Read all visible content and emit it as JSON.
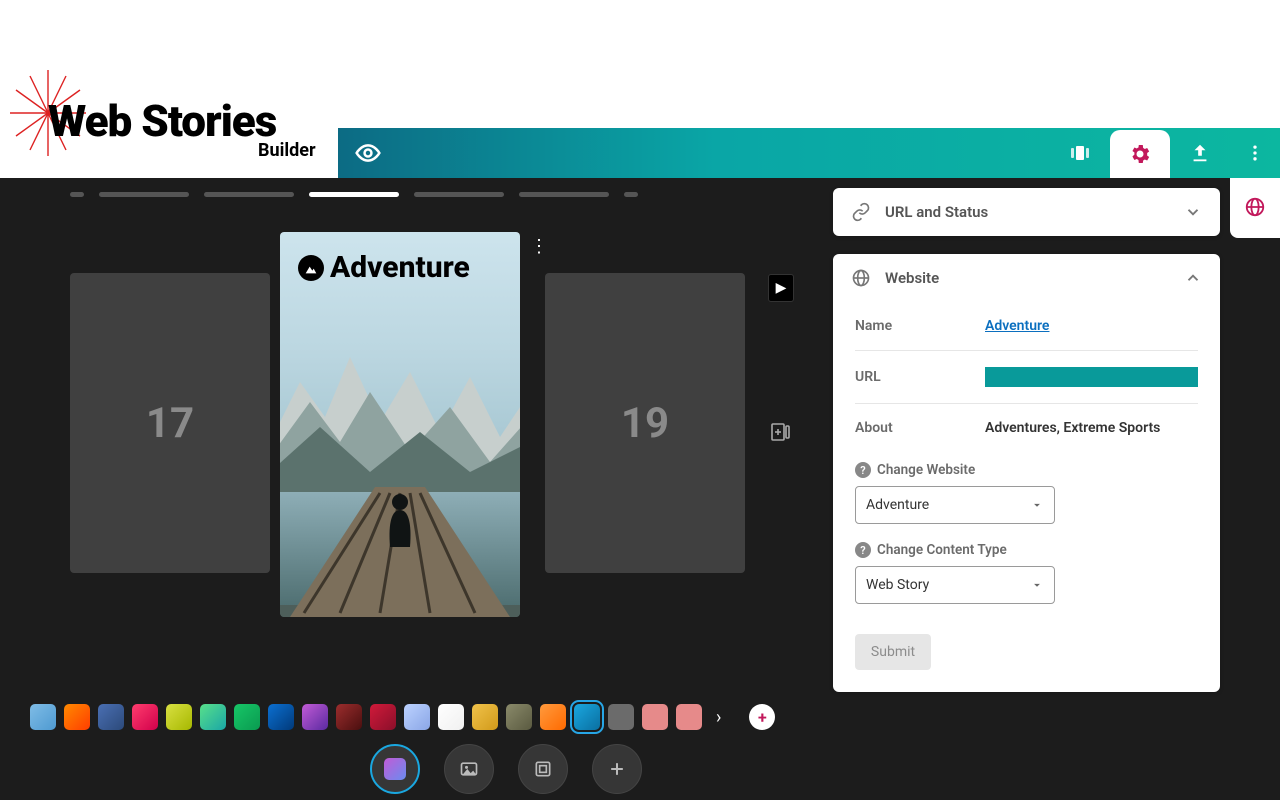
{
  "app": {
    "title1": "Web Stories",
    "title2": "Builder"
  },
  "cards": {
    "left": "17",
    "right": "19",
    "story_title": "Adventure"
  },
  "panel": {
    "url_status_title": "URL and Status",
    "website_title": "Website",
    "name_label": "Name",
    "name_value": "Adventure",
    "url_label": "URL",
    "about_label": "About",
    "about_value": "Adventures, Extreme Sports",
    "change_website_label": "Change Website",
    "change_website_value": "Adventure",
    "change_content_label": "Change Content Type",
    "change_content_value": "Web Story",
    "submit": "Submit"
  },
  "swatches": [
    "linear-gradient(135deg,#7fbce6,#4e9ad1)",
    "linear-gradient(135deg,#ff8a00,#ff3d00)",
    "linear-gradient(135deg,#4a6fb3,#2c4a7a)",
    "linear-gradient(135deg,#ff3d6e,#d1004b)",
    "linear-gradient(135deg,#d9e042,#a6b800)",
    "linear-gradient(135deg,#58e08a,#1aa6a6)",
    "linear-gradient(135deg,#17c667,#0a9a50)",
    "linear-gradient(135deg,#0b6fd1,#013a7a)",
    "linear-gradient(135deg,#c25bd6,#5a2aa0)",
    "linear-gradient(135deg,#9c2d2d,#4a0f0f)",
    "linear-gradient(135deg,#d11a3a,#8a0f2a)",
    "linear-gradient(135deg,#bcd2ff,#8aa6e6)",
    "linear-gradient(135deg,#fff,#f0f0f0)",
    "linear-gradient(135deg,#f0c24a,#d19a1a)",
    "linear-gradient(135deg,#8a8a6a,#5a5a40)",
    "linear-gradient(135deg,#ff9a3d,#ff6a00)",
    "linear-gradient(135deg,#1aa7e0,#0a6fa0)",
    "#6b6b6b",
    "#e68a8a",
    "#e68a8a"
  ],
  "swatch_selected_index": 16
}
